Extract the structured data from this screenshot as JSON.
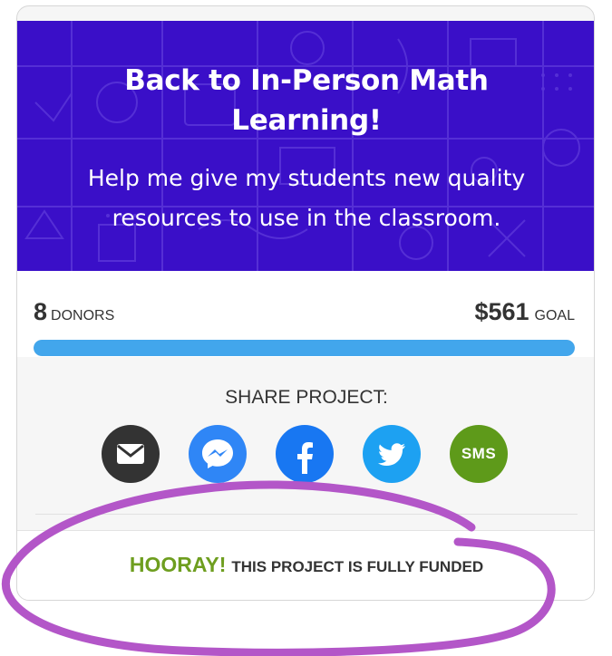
{
  "hero": {
    "title": "Back to In-Person Math Learning!",
    "subtitle": "Help me give my students new quality resources to use in the classroom.",
    "background": "#3a0fc8"
  },
  "stats": {
    "donors_count": "8",
    "donors_label": "DONORS",
    "goal_amount": "$561",
    "goal_label": "GOAL",
    "progress_fraction": 1.0,
    "progress_color": "#42a6ec"
  },
  "share": {
    "label": "SHARE PROJECT:",
    "buttons": [
      {
        "icon": "email-icon",
        "color": "#333333"
      },
      {
        "icon": "messenger-icon",
        "color": "#2f86f6"
      },
      {
        "icon": "facebook-icon",
        "color": "#1877f2"
      },
      {
        "icon": "twitter-icon",
        "color": "#1da1f2"
      },
      {
        "icon": "sms-icon",
        "color": "#5e9a1a",
        "text": "SMS"
      }
    ]
  },
  "banner": {
    "hooray": "HOORAY!",
    "message": "THIS PROJECT IS FULLY FUNDED",
    "hooray_color": "#6e9e1f"
  },
  "annotation": {
    "color": "#b356c8"
  }
}
